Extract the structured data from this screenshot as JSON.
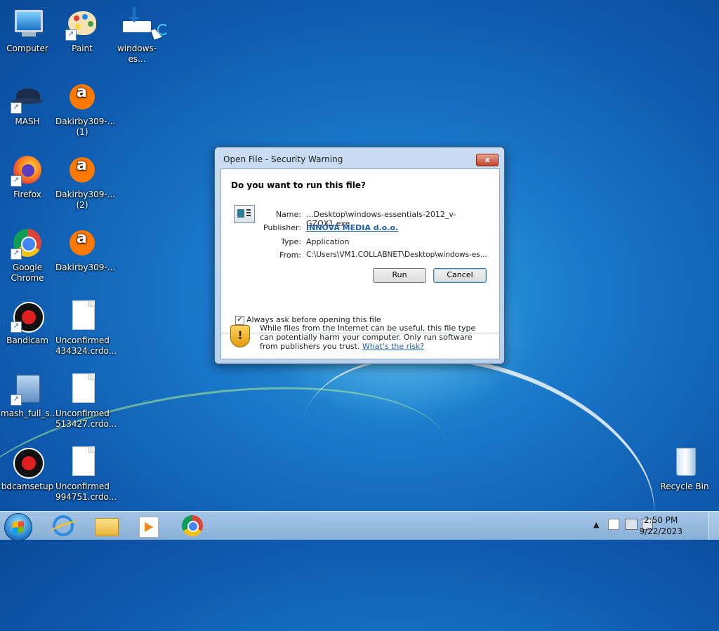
{
  "desktop_icons": {
    "computer": "Computer",
    "paint": "Paint",
    "windows_ess": "windows-es...",
    "mash": "MASH",
    "dak1_a": "Dakirby309-...",
    "dak1_b": "(1)",
    "firefox": "Firefox",
    "dak2_a": "Dakirby309-...",
    "dak2_b": "(2)",
    "chrome_a": "Google",
    "chrome_b": "Chrome",
    "dak3": "Dakirby309-...",
    "bandicam": "Bandicam",
    "unc1_a": "Unconfirmed",
    "unc1_b": "434324.crdo...",
    "mash_full": "mash_full_s...",
    "unc2_a": "Unconfirmed",
    "unc2_b": "513427.crdo...",
    "bdcam": "bdcamsetup",
    "unc3_a": "Unconfirmed",
    "unc3_b": "994751.crdo...",
    "recycle": "Recycle Bin"
  },
  "dialog": {
    "title": "Open File - Security Warning",
    "close": "x",
    "question": "Do you want to run this file?",
    "name_label": "Name:",
    "name_value": "...Desktop\\windows-essentials-2012_v-GZQX1.exe",
    "publisher_label": "Publisher:",
    "publisher_value": "INNOVA MEDIA d.o.o.",
    "type_label": "Type:",
    "type_value": "Application",
    "from_label": "From:",
    "from_value": "C:\\Users\\VM1.COLLABNET\\Desktop\\windows-es...",
    "run": "Run",
    "cancel": "Cancel",
    "checkbox_checked": "✓",
    "checkbox_label": "Always ask before opening this file",
    "warning_text": "While files from the Internet can be useful, this file type can potentially harm your computer. Only run software from publishers you trust.",
    "risk_link": "What's the risk?"
  },
  "taskbar": {
    "clock_time": "2:50 PM",
    "clock_date": "9/22/2023",
    "tray_arrow": "▲"
  },
  "icons": [
    "computer-icon",
    "paint-icon",
    "download-icon",
    "mash-icon",
    "avast-icon",
    "firefox-icon",
    "chrome-icon",
    "bandicam-icon",
    "document-icon",
    "installer-icon",
    "recycle-bin-icon",
    "shield-icon",
    "start-orb",
    "ie-icon",
    "explorer-icon",
    "media-player-icon"
  ]
}
